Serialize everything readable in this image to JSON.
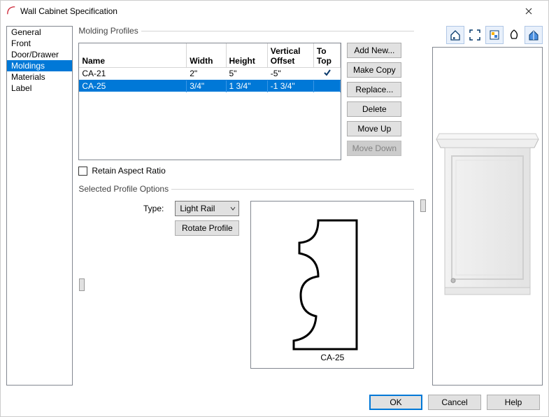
{
  "title": "Wall Cabinet Specification",
  "sidebar": {
    "items": [
      {
        "label": "General"
      },
      {
        "label": "Front"
      },
      {
        "label": "Door/Drawer"
      },
      {
        "label": "Moldings",
        "selected": true
      },
      {
        "label": "Materials"
      },
      {
        "label": "Label"
      }
    ]
  },
  "molding": {
    "legend": "Molding Profiles",
    "headers": {
      "name": "Name",
      "width": "Width",
      "height": "Height",
      "voffset": "Vertical Offset",
      "totop": "To Top"
    },
    "rows": [
      {
        "name": "CA-21",
        "width": "2\"",
        "height": "5\"",
        "voffset": "-5\"",
        "totop": true,
        "selected": false
      },
      {
        "name": "CA-25",
        "width": "3/4\"",
        "height": "1 3/4\"",
        "voffset": "-1 3/4\"",
        "totop": false,
        "selected": true
      }
    ],
    "buttons": {
      "add": "Add New...",
      "copy": "Make Copy",
      "replace": "Replace...",
      "delete": "Delete",
      "moveup": "Move Up",
      "movedown": "Move Down"
    },
    "retain": "Retain Aspect Ratio"
  },
  "options": {
    "legend": "Selected Profile Options",
    "type_label": "Type:",
    "type_value": "Light Rail",
    "rotate": "Rotate Profile",
    "preview_label": "CA-25"
  },
  "footer": {
    "ok": "OK",
    "cancel": "Cancel",
    "help": "Help"
  }
}
